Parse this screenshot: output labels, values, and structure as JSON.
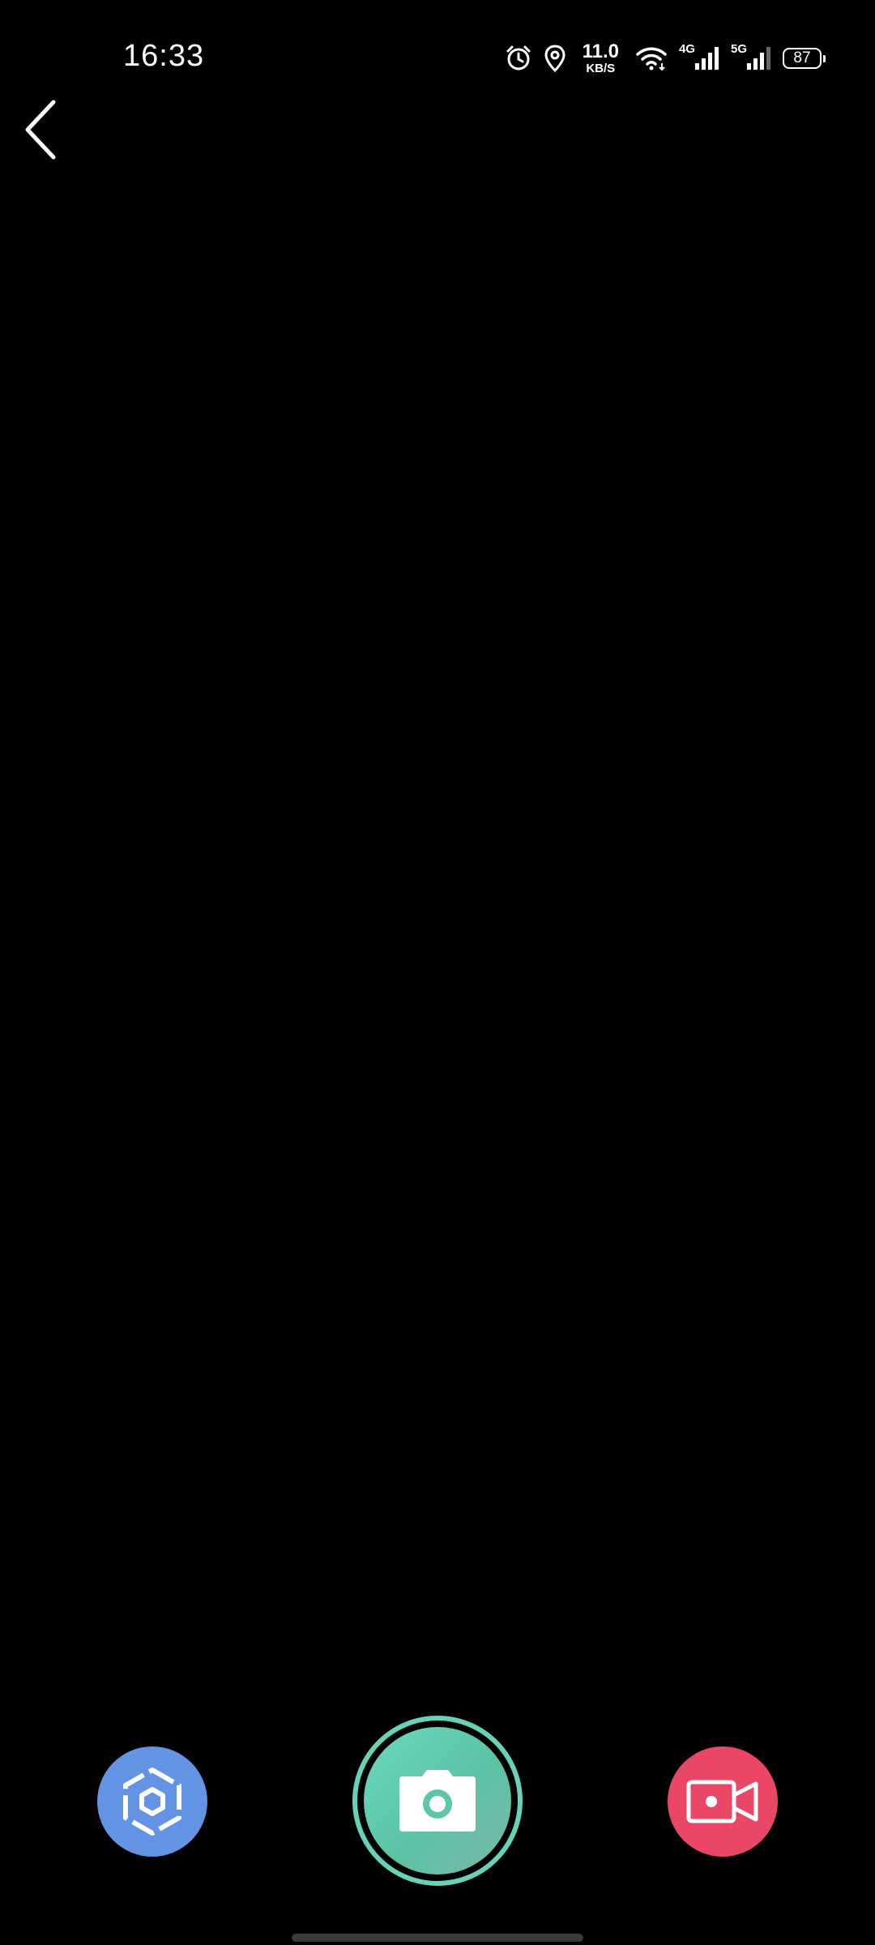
{
  "status_bar": {
    "time": "16:33",
    "net_speed_value": "11.0",
    "net_speed_unit": "KB/S",
    "signal_1_label": "4G",
    "signal_2_label": "5G",
    "battery_level": "87",
    "icons": [
      "alarm-icon",
      "location-icon",
      "wifi-icon",
      "cellular-signal-icon",
      "cellular-signal-icon",
      "battery-icon"
    ]
  },
  "navigation": {
    "back_icon": "chevron-left-icon"
  },
  "controls": {
    "scan_icon": "hexagon-scan-icon",
    "scan_color": "#6393e3",
    "shutter_icon": "camera-icon",
    "shutter_color": "#66d3b8",
    "video_icon": "video-camera-icon",
    "video_color": "#e94765"
  }
}
